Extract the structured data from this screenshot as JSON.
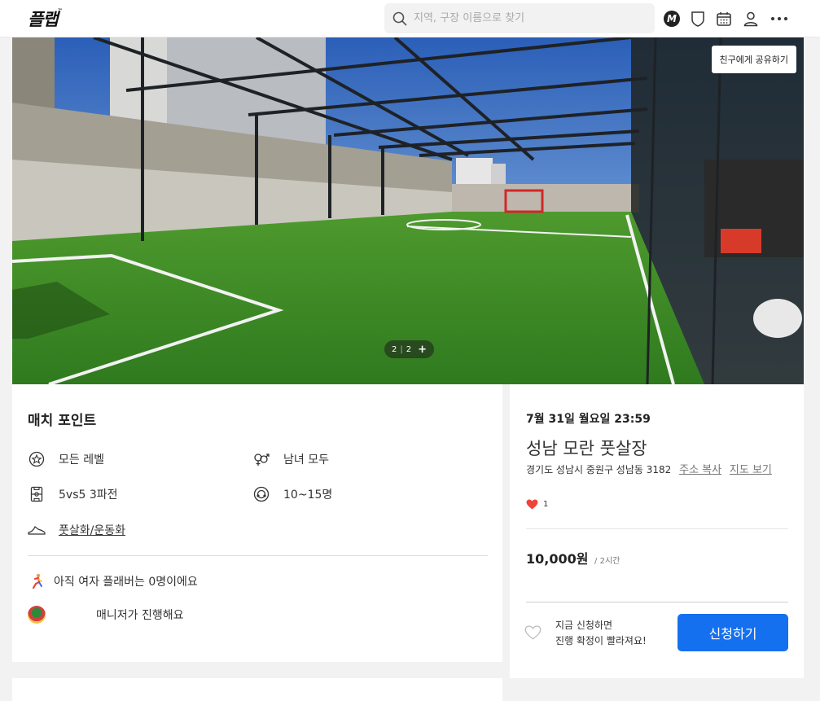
{
  "header": {
    "logo": "플랩",
    "logo_tm": "™",
    "search_placeholder": "지역, 구장 이름으로 찾기",
    "icons": [
      "m-badge-icon",
      "shield-icon",
      "calendar-icon",
      "user-icon",
      "more-icon"
    ],
    "m_badge": "M"
  },
  "hero": {
    "share_label": "친구에게 공유하기",
    "pager_current": "2",
    "pager_total": "2",
    "pager_plus": "+"
  },
  "match_point": {
    "title": "매치 포인트",
    "level": "모든 레벨",
    "gender": "남녀 모두",
    "format": "5vs5 3파전",
    "players": "10~15명",
    "shoes": "풋살화/운동화",
    "female_notice": "아직 여자 플래버는 0명이에요",
    "manager_notice": "매니저가 진행해요"
  },
  "match_info": {
    "date": "7월 31일 월요일 23:59",
    "venue": "성남 모란 풋살장",
    "address": "경기도 성남시 중원구 성남동 3182",
    "copy_address": "주소 복사",
    "view_map": "지도 보기",
    "likes": "1",
    "price": "10,000원",
    "duration": "/ 2시간",
    "apply_message_line1": "지금 신청하면",
    "apply_message_line2": "진행 확정이 빨라져요!",
    "apply_button": "신청하기"
  },
  "colors": {
    "accent": "#1570ef",
    "heart": "#f04438",
    "turf": "#3f8f2a"
  }
}
